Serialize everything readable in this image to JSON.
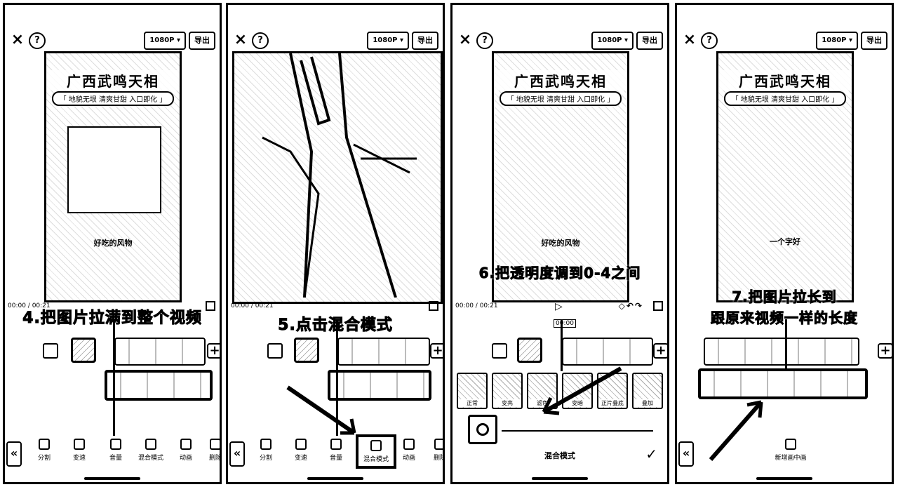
{
  "panels": [
    {
      "topbar": {
        "resolution": "1080P ▾",
        "export": "导出"
      },
      "video": {
        "title": "广西武鸣天相",
        "subtitle": "「 地貌无垠 清爽甘甜 入口即化 」",
        "caption": "好吃的风物"
      },
      "timecode": "00:00 / 00:21",
      "step_caption": "4.把图片拉满到整个视频",
      "tools": [
        "分割",
        "变速",
        "音量",
        "混合模式",
        "动画",
        "删除"
      ]
    },
    {
      "topbar": {
        "resolution": "1080P ▾",
        "export": "导出"
      },
      "timecode": "00:00 / 00:21",
      "step_caption": "5.点击混合模式",
      "tools": [
        "分割",
        "变速",
        "音量",
        "混合模式",
        "动画",
        "删除"
      ]
    },
    {
      "topbar": {
        "resolution": "1080P ▾",
        "export": "导出"
      },
      "video": {
        "title": "广西武鸣天相",
        "subtitle": "「 地貌无垠 清爽甘甜 入口即化 」",
        "caption": "好吃的风物"
      },
      "timecode": "00:00 / 00:21",
      "step_caption": "6.把透明度调到0-4之间",
      "mark": "00:00",
      "blend_modes": [
        "正常",
        "变亮",
        "滤色",
        "变暗",
        "正片叠底",
        "叠加"
      ],
      "blend_title": "混合模式",
      "confirm": "✓"
    },
    {
      "topbar": {
        "resolution": "1080P ▾",
        "export": "导出"
      },
      "video": {
        "title": "广西武鸣天相",
        "subtitle": "「 地貌无垠 清爽甘甜 入口即化 」",
        "caption": "一个字好"
      },
      "step_caption_1": "7.把图片拉长到",
      "step_caption_2": "跟原来视频一样的长度",
      "tools": [
        "新增画中画"
      ]
    }
  ],
  "icons": {
    "close": "×",
    "help": "?",
    "back": "«",
    "plus": "+",
    "play": "▷",
    "undo_redo": "◇↶↷"
  }
}
